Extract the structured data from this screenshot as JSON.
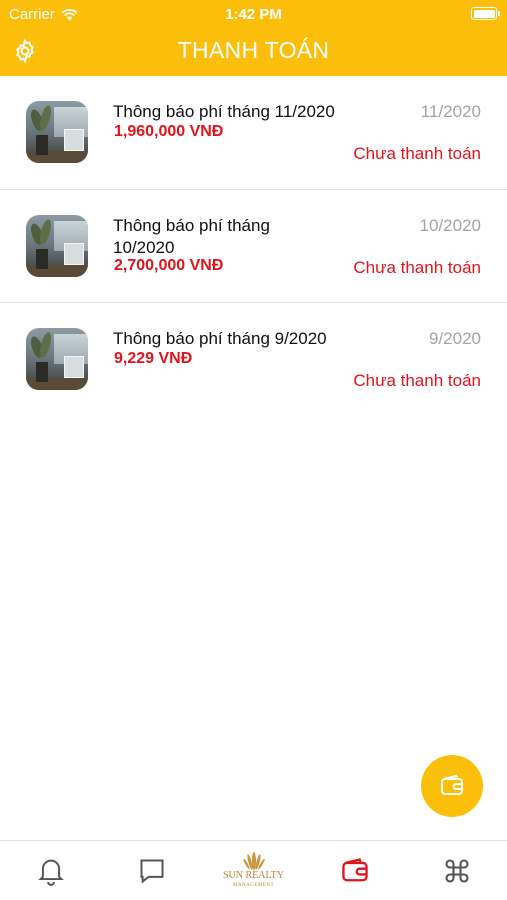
{
  "status_bar": {
    "carrier": "Carrier",
    "time": "1:42 PM"
  },
  "header": {
    "title": "THANH TOÁN",
    "settings_icon": "gear-icon"
  },
  "payments": [
    {
      "title": "Thông báo phí tháng 11/2020",
      "amount": "1,960,000 VNĐ",
      "period": "11/2020",
      "status": "Chưa thanh toán"
    },
    {
      "title": "Thông báo phí tháng 10/2020",
      "amount": "2,700,000 VNĐ",
      "period": "10/2020",
      "status": "Chưa thanh toán"
    },
    {
      "title": "Thông báo phí tháng 9/2020",
      "amount": "9,229 VNĐ",
      "period": "9/2020",
      "status": "Chưa thanh toán"
    }
  ],
  "fab": {
    "icon": "wallet-icon"
  },
  "tabbar": {
    "tabs": [
      {
        "icon": "bell-icon",
        "active": false
      },
      {
        "icon": "chat-icon",
        "active": false
      },
      {
        "icon": "sun-realty-logo",
        "logo_text": "SUN REALTY",
        "logo_sub": "MANAGEMENT",
        "active": false
      },
      {
        "icon": "wallet-icon",
        "active": true
      },
      {
        "icon": "command-icon",
        "active": false
      }
    ]
  },
  "colors": {
    "accent": "#fbbf0b",
    "alert_red": "#e0141b",
    "muted_gray": "#a3a3a3",
    "inactive_icon": "#555555",
    "active_tab": "#e0141b"
  }
}
